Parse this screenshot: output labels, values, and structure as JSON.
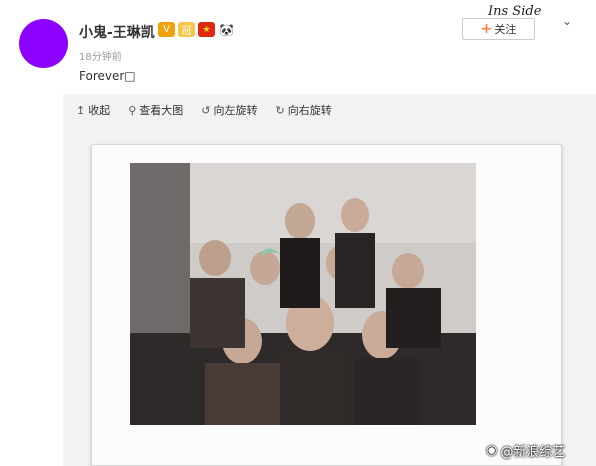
{
  "post": {
    "username": "小鬼-王琳凯",
    "badges": [
      "V",
      "冠",
      "★",
      "🐼"
    ],
    "timestamp": "18分钟前",
    "text": "Forever□",
    "follow_label": "关注",
    "watermark_top": "Ins Side"
  },
  "toolbar": {
    "collapse_label": "收起",
    "view_large_label": "查看大图",
    "rotate_left_label": "向左旋转",
    "rotate_right_label": "向右旋转"
  },
  "watermark_bottom": "@新浪综艺",
  "colors": {
    "avatar": "#8b00ff",
    "follow_plus": "#ff8140",
    "media_bg": "#f2f2f5"
  }
}
